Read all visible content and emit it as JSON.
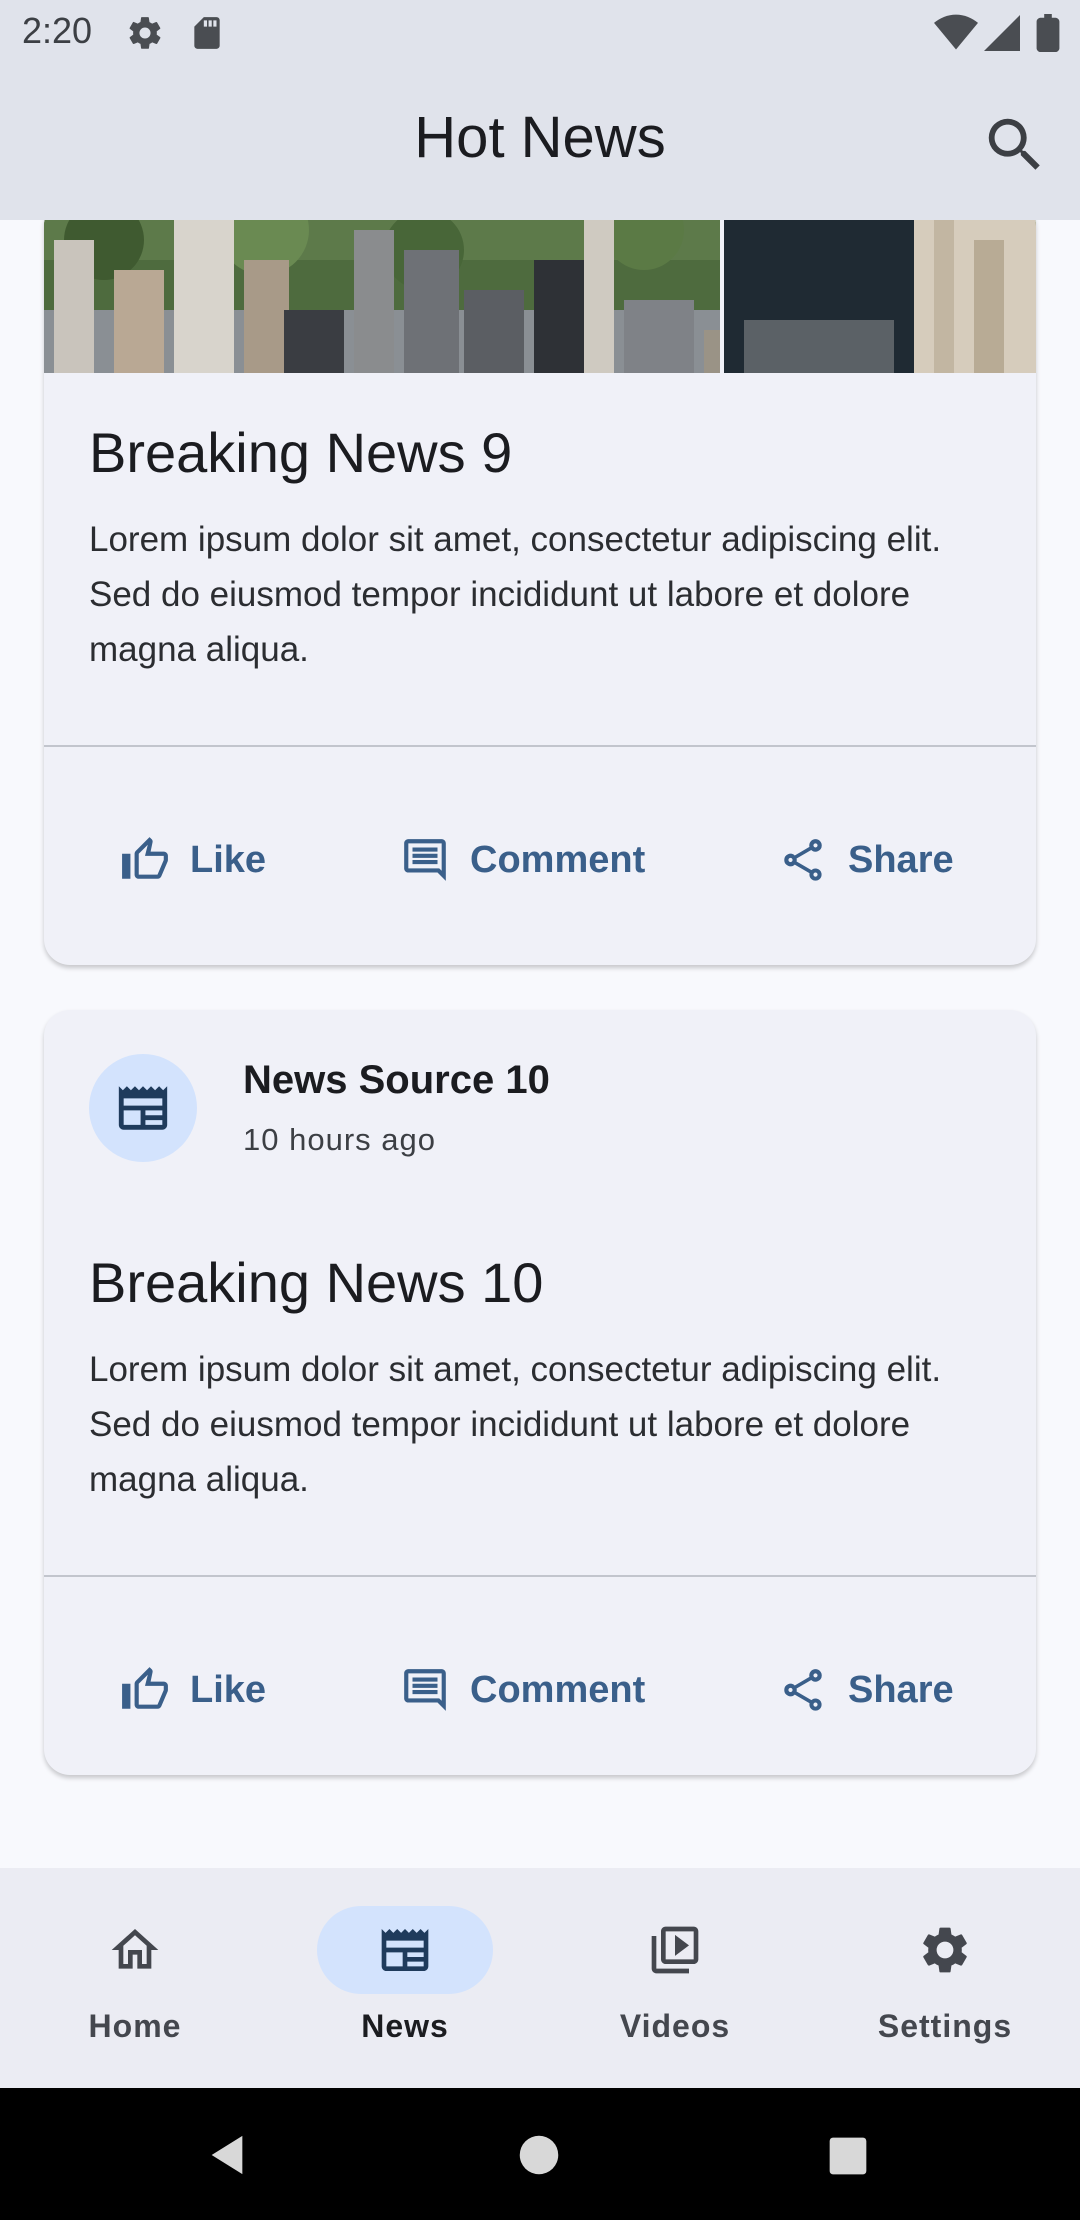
{
  "status_bar": {
    "time": "2:20",
    "icons": [
      "settings-icon",
      "sd-card-icon",
      "wifi-icon",
      "signal-icon",
      "battery-icon"
    ]
  },
  "app_bar": {
    "title": "Hot News",
    "search_icon": "search-icon"
  },
  "feed": [
    {
      "title": "Breaking News 9",
      "body": "Lorem ipsum dolor sit amet, consectetur adipiscing elit. Sed do eiusmod tempor incididunt ut labore et dolore magna aliqua.",
      "actions": {
        "like": "Like",
        "comment": "Comment",
        "share": "Share"
      }
    },
    {
      "source": "News Source 10",
      "time": "10 hours ago",
      "title": "Breaking News 10",
      "body": "Lorem ipsum dolor sit amet, consectetur adipiscing elit. Sed do eiusmod tempor incididunt ut labore et dolore magna aliqua.",
      "actions": {
        "like": "Like",
        "comment": "Comment",
        "share": "Share"
      }
    }
  ],
  "bottom_nav": {
    "items": [
      {
        "label": "Home",
        "icon": "home-icon",
        "active": false
      },
      {
        "label": "News",
        "icon": "newspaper-icon",
        "active": true
      },
      {
        "label": "Videos",
        "icon": "video-library-icon",
        "active": false
      },
      {
        "label": "Settings",
        "icon": "gear-icon",
        "active": false
      }
    ]
  },
  "colors": {
    "app_bar": "#e0e3eb",
    "card": "#f0f1f8",
    "accent": "#3a5f8a",
    "active_pill": "#d3e3fd",
    "page": "#f8f9fd"
  }
}
